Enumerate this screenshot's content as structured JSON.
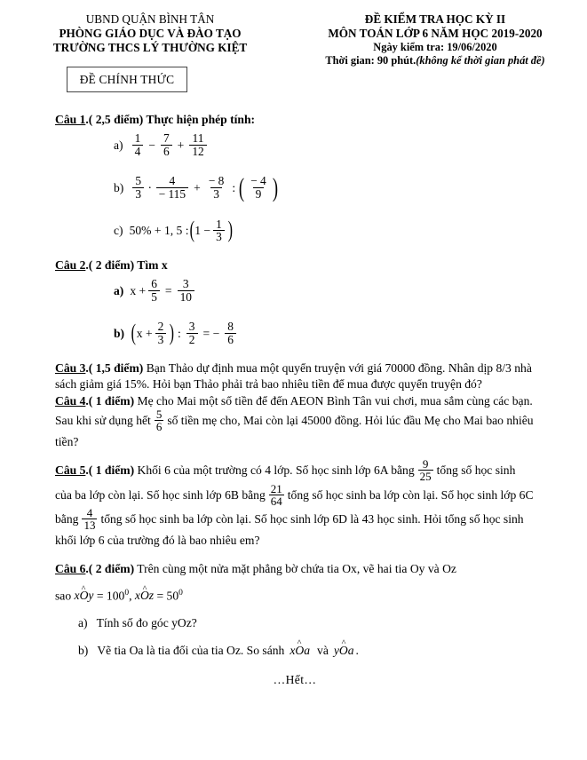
{
  "document": {
    "type": "exam-paper",
    "language": "vi"
  },
  "header": {
    "left": {
      "line1": "UBND QUẬN BÌNH TÂN",
      "line2": "PHÒNG GIÁO DỤC VÀ ĐÀO TẠO",
      "line3": "TRƯỜNG THCS LÝ THƯỜNG KIỆT",
      "official_box": "ĐỀ CHÍNH THỨC"
    },
    "right": {
      "line1": "ĐỀ KIỂM TRA HỌC KỲ II",
      "line2": "MÔN TOÁN LỚP 6 NĂM HỌC 2019-2020",
      "line3": "Ngày kiểm tra: 19/06/2020",
      "line4_prefix": "Thời gian: 90 phút.",
      "line4_italic": "(không kể thời gian phát đề)"
    }
  },
  "questions": {
    "q1": {
      "label": "Câu 1",
      "points": ".( 2,5 điểm)",
      "prompt": " Thực hiện phép tính:",
      "a": {
        "marker": "a)",
        "f1": {
          "num": "1",
          "den": "4"
        },
        "op1": "−",
        "f2": {
          "num": "7",
          "den": "6"
        },
        "op2": "+",
        "f3": {
          "num": "11",
          "den": "12"
        }
      },
      "b": {
        "marker": "b)",
        "f1": {
          "num": "5",
          "den": "3"
        },
        "op1": "·",
        "f2": {
          "num": "4",
          "den": "− 115"
        },
        "op2": "+",
        "f3": {
          "num": "− 8",
          "den": "3"
        },
        "op3": ":",
        "f4": {
          "num": "− 4",
          "den": "9"
        }
      },
      "c": {
        "marker": "c)",
        "expr1": "50% + 1, 5 :",
        "inner_lead": "1 −",
        "f1": {
          "num": "1",
          "den": "3"
        }
      }
    },
    "q2": {
      "label": "Câu 2",
      "points": ".( 2 điểm)",
      "prompt": " Tìm x",
      "a": {
        "marker": "a)",
        "lhs": "x +",
        "f1": {
          "num": "6",
          "den": "5"
        },
        "eq": "=",
        "f2": {
          "num": "3",
          "den": "10"
        }
      },
      "b": {
        "marker": "b)",
        "lhs": "x +",
        "f1": {
          "num": "2",
          "den": "3"
        },
        "op": ":",
        "f2": {
          "num": "3",
          "den": "2"
        },
        "eq": "= −",
        "f3": {
          "num": "8",
          "den": "6"
        }
      }
    },
    "q3": {
      "label": "Câu 3",
      "points": ".( 1,5 điểm)",
      "text": " Bạn Thảo dự định mua một quyển truyện với giá 70000 đồng. Nhân dịp 8/3 nhà sách giảm giá 15%. Hỏi bạn Thảo phải trả bao nhiêu tiền để mua được quyển truyện đó?"
    },
    "q4": {
      "label": "Câu 4",
      "points": ".( 1 điểm)",
      "text_before": " Mẹ cho Mai một số tiền để đến AEON Bình Tân vui chơi, mua sắm cùng các bạn. Sau khi sử dụng hết",
      "frac": {
        "num": "5",
        "den": "6"
      },
      "text_after": "số tiền mẹ cho, Mai còn lại 45000 đồng. Hỏi lúc đầu Mẹ cho Mai bao nhiêu tiền?"
    },
    "q5": {
      "label": "Câu 5",
      "points": ".( 1 điểm)",
      "t1": " Khối 6 của một trường có 4 lớp. Số học sinh lớp 6A bằng",
      "f1": {
        "num": "9",
        "den": "25"
      },
      "t2": "tổng số học sinh của ba lớp còn lại. Số học sinh lớp 6B bằng",
      "f2": {
        "num": "21",
        "den": "64"
      },
      "t3": "tổng số học sinh ba lớp còn lại. Số học sinh lớp 6C bằng",
      "f3": {
        "num": "4",
        "den": "13"
      },
      "t4": "tổng số học sinh ba lớp còn lại. Số học sinh lớp 6D là 43 học sinh. Hỏi tổng số học sinh khối lớp 6 của trường đó là bao nhiêu em?"
    },
    "q6": {
      "label": "Câu 6",
      "points": ".( 2 điểm)",
      "text": " Trên cùng một nửa mặt phẳng bờ chứa tia Ox, vẽ hai tia Oy và Oz",
      "sao_prefix": "sao",
      "angle1": {
        "a": "x",
        "o": "O",
        "b": "y"
      },
      "angle1_value": "= 100",
      "angle1_deg": "0",
      "comma": ",",
      "angle2": {
        "a": "x",
        "o": "O",
        "b": "z"
      },
      "angle2_value": "= 50",
      "angle2_deg": "0",
      "a": {
        "marker": "a)",
        "text": "Tính số đo góc yOz?"
      },
      "b": {
        "marker": "b)",
        "text_before": "Vẽ tia Oa là tia đối của tia Oz. So sánh",
        "angle1": {
          "a": "x",
          "o": "O",
          "b": "a"
        },
        "mid": "và",
        "angle2": {
          "a": "y",
          "o": "O",
          "b": "a"
        },
        "text_after": "."
      }
    }
  },
  "footer": {
    "end_marker": "…Hết…"
  }
}
